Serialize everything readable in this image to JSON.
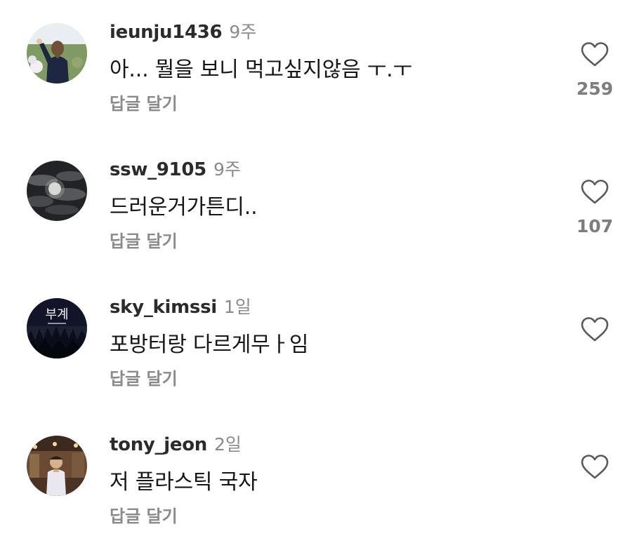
{
  "comments": [
    {
      "username": "ieunju1436",
      "time": "9주",
      "text": "아... 뭘을 보니 먹고싶지않음 ㅜ.ㅜ",
      "reply_label": "답글 달기",
      "likes": "259",
      "avatar_icon": "person-portrait"
    },
    {
      "username": "ssw_9105",
      "time": "9주",
      "text": "드러운거가튼디..",
      "reply_label": "답글 달기",
      "likes": "107",
      "avatar_icon": "moon-night-sky"
    },
    {
      "username": "sky_kimssi",
      "time": "1일",
      "text": "포방터랑 다르게무ㅏ임",
      "reply_label": "답글 달기",
      "likes": "",
      "avatar_icon": "forest-night",
      "avatar_text": "부계"
    },
    {
      "username": "tony_jeon",
      "time": "2일",
      "text": "저 플라스틱 국자",
      "reply_label": "답글 달기",
      "likes": "",
      "avatar_icon": "person-photo"
    }
  ],
  "colors": {
    "username": "#2b2b2b",
    "muted": "#8a8a8a",
    "heart_stroke": "#5a5a5a"
  }
}
